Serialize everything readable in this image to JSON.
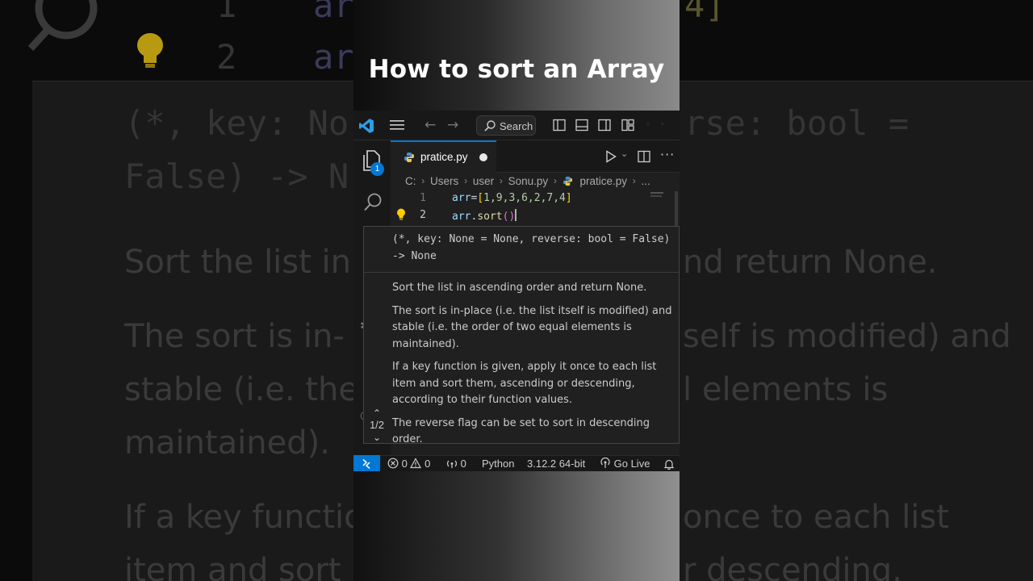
{
  "video_title": "How to sort an Array",
  "window": {
    "search_label": "Search"
  },
  "activity_bar": {
    "explorer_badge": "1"
  },
  "tab": {
    "filename": "pratice.py"
  },
  "breadcrumb": {
    "items": [
      "C:",
      "Users",
      "user",
      "Sonu.py",
      "pratice.py",
      "..."
    ]
  },
  "editor": {
    "lines": [
      {
        "number": "1",
        "code": "arr=[1,9,3,6,2,7,4]"
      },
      {
        "number": "2",
        "code": "arr.sort()"
      }
    ]
  },
  "hover": {
    "signature": "(*, key: None = None, reverse: bool = False) -> None",
    "paragraphs": [
      "Sort the list in ascending order and return None.",
      "The sort is in-place (i.e. the list itself is modified) and stable (i.e. the order of two equal elements is maintained).",
      "If a key function is given, apply it once to each list item and sort them, ascending or descending, according to their function values.",
      "The reverse flag can be set to sort in descending order."
    ],
    "page_indicator": "1/2"
  },
  "status_bar": {
    "errors": "0",
    "warnings": "0",
    "ports": "0",
    "language": "Python",
    "interpreter": "3.12.2 64-bit",
    "go_live": "Go Live"
  },
  "background": {
    "line_numbers": [
      "1",
      "2"
    ],
    "code_fragments": [
      "arr",
      "arr",
      "4]"
    ],
    "signature_line1_left": "(*, key: No",
    "signature_line1_right": "rse: bool =",
    "signature_line2_left": "False) -> N",
    "doc_line1_left": "Sort the list in",
    "doc_line1_right": "nd return None.",
    "doc_line2_left": "The sort is in-",
    "doc_line2_right": "self is modified) and",
    "doc_line3_left": "stable (i.e. the",
    "doc_line3_right": "l elements is",
    "doc_line4_left": "maintained).",
    "doc_line5_left": "If a key functio",
    "doc_line5_right": "once to each list",
    "doc_line6_left": "item and sort",
    "doc_line6_right": "r descending."
  },
  "colors": {
    "accent": "#0078d4",
    "editor_bg": "#1f1f1f",
    "chrome_bg": "#181818",
    "text": "#cccccc"
  },
  "icons": {
    "titlebar": [
      "vscode-logo-icon",
      "menu-icon",
      "back-arrow-icon",
      "forward-arrow-icon",
      "search-icon",
      "toggle-sidebar-icon",
      "toggle-panel-icon",
      "toggle-secondary-sidebar-icon",
      "customize-layout-icon"
    ],
    "activity": [
      "files-icon",
      "search-icon"
    ],
    "editor": [
      "python-file-icon",
      "run-icon",
      "split-editor-icon",
      "more-actions-icon",
      "lightbulb-icon"
    ],
    "status": [
      "remote-icon",
      "error-icon",
      "warning-icon",
      "ports-icon",
      "broadcast-icon",
      "bell-icon"
    ]
  }
}
